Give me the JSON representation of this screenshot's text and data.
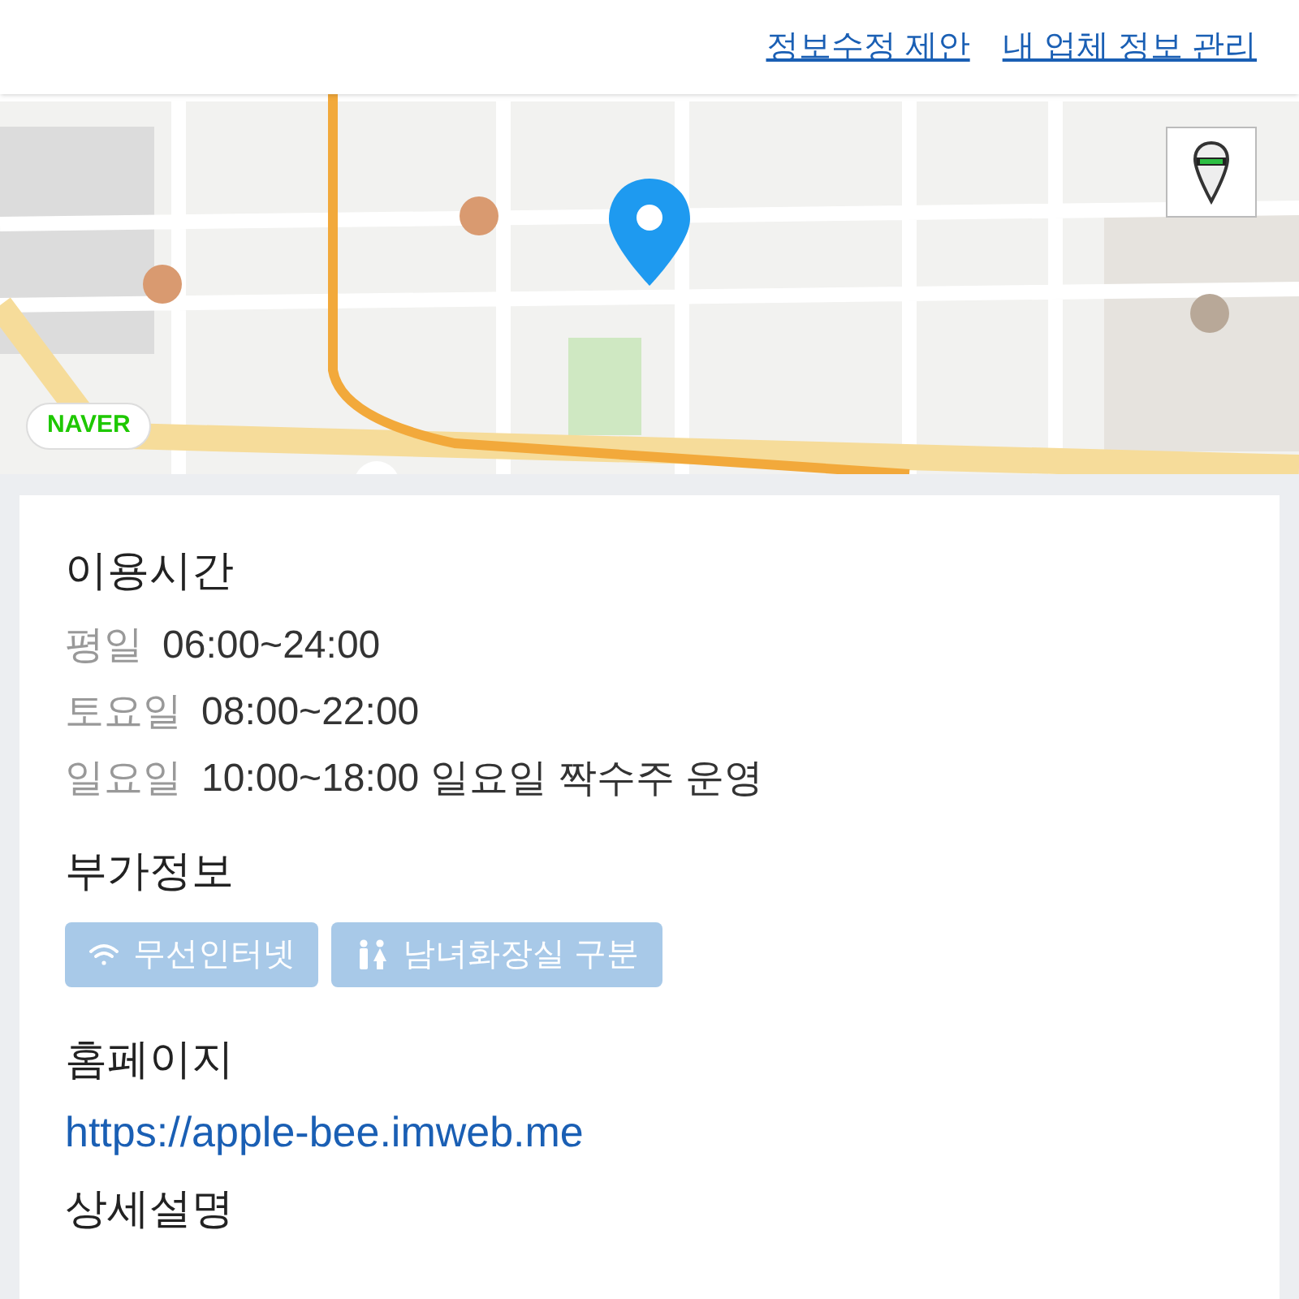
{
  "header_links": [
    "정보수정 제안",
    "내 업체 정보 관리"
  ],
  "map": {
    "kind": "picture",
    "badge": "NAVER"
  },
  "hours": {
    "title": "이용시간",
    "rows": [
      {
        "day": "평일",
        "time": "06:00~24:00"
      },
      {
        "day": "토요일",
        "time": "08:00~22:00"
      },
      {
        "day": "일요일",
        "time": "10:00~18:00 일요일 짝수주 운영"
      }
    ]
  },
  "extra": {
    "title": "부가정보",
    "tags": [
      {
        "kind": "wifi",
        "label": "무선인터넷"
      },
      {
        "kind": "restroom",
        "label": "남녀화장실 구분"
      }
    ]
  },
  "homepage": {
    "title": "홈페이지",
    "url": "https://apple-bee.imweb.me"
  },
  "description": {
    "title": "상세설명"
  }
}
